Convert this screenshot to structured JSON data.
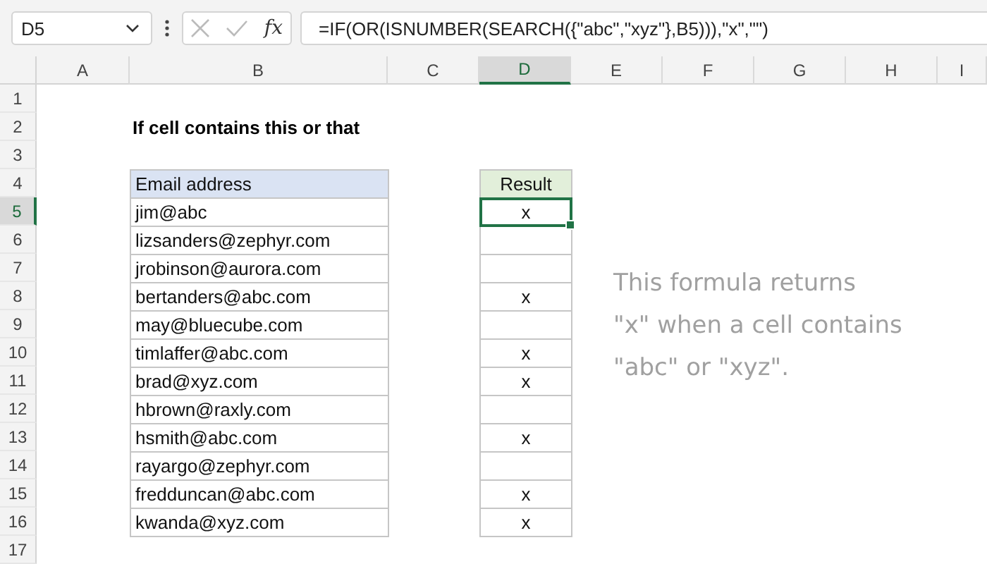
{
  "name_box": "D5",
  "function_button": "fx",
  "formula": "=IF(OR(ISNUMBER(SEARCH({\"abc\",\"xyz\"},B5))),\"x\",\"\")",
  "columns": [
    {
      "label": "A",
      "selected": false
    },
    {
      "label": "B",
      "selected": false
    },
    {
      "label": "C",
      "selected": false
    },
    {
      "label": "D",
      "selected": true
    },
    {
      "label": "E",
      "selected": false
    },
    {
      "label": "F",
      "selected": false
    },
    {
      "label": "G",
      "selected": false
    },
    {
      "label": "H",
      "selected": false
    },
    {
      "label": "I",
      "selected": false
    }
  ],
  "rows": [
    {
      "label": "1",
      "selected": false
    },
    {
      "label": "2",
      "selected": false
    },
    {
      "label": "3",
      "selected": false
    },
    {
      "label": "4",
      "selected": false
    },
    {
      "label": "5",
      "selected": true
    },
    {
      "label": "6",
      "selected": false
    },
    {
      "label": "7",
      "selected": false
    },
    {
      "label": "8",
      "selected": false
    },
    {
      "label": "9",
      "selected": false
    },
    {
      "label": "10",
      "selected": false
    },
    {
      "label": "11",
      "selected": false
    },
    {
      "label": "12",
      "selected": false
    },
    {
      "label": "13",
      "selected": false
    },
    {
      "label": "14",
      "selected": false
    },
    {
      "label": "15",
      "selected": false
    },
    {
      "label": "16",
      "selected": false
    },
    {
      "label": "17",
      "selected": false
    }
  ],
  "title": "If cell contains this or that",
  "table": {
    "email_header": "Email address",
    "result_header": "Result",
    "rows": [
      {
        "email": "jim@abc",
        "result": "x",
        "selected": true
      },
      {
        "email": "lizsanders@zephyr.com",
        "selected": false
      },
      {
        "email": "jrobinson@aurora.com",
        "selected": false
      },
      {
        "email": "bertanders@abc.com",
        "result": "x",
        "selected": false
      },
      {
        "email": "may@bluecube.com",
        "selected": false
      },
      {
        "email": "timlaffer@abc.com",
        "result": "x",
        "selected": false
      },
      {
        "email": "brad@xyz.com",
        "result": "x",
        "selected": false
      },
      {
        "email": "hbrown@raxly.com",
        "selected": false
      },
      {
        "email": "hsmith@abc.com",
        "result": "x",
        "selected": false
      },
      {
        "email": "rayargo@zephyr.com",
        "selected": false
      },
      {
        "email": "fredduncan@abc.com",
        "result": "x",
        "selected": false
      },
      {
        "email": "kwanda@xyz.com",
        "result": "x",
        "selected": false
      }
    ]
  },
  "note": "This formula returns\n\"x\" when a cell contains\n\"abc\" or \"xyz\"."
}
